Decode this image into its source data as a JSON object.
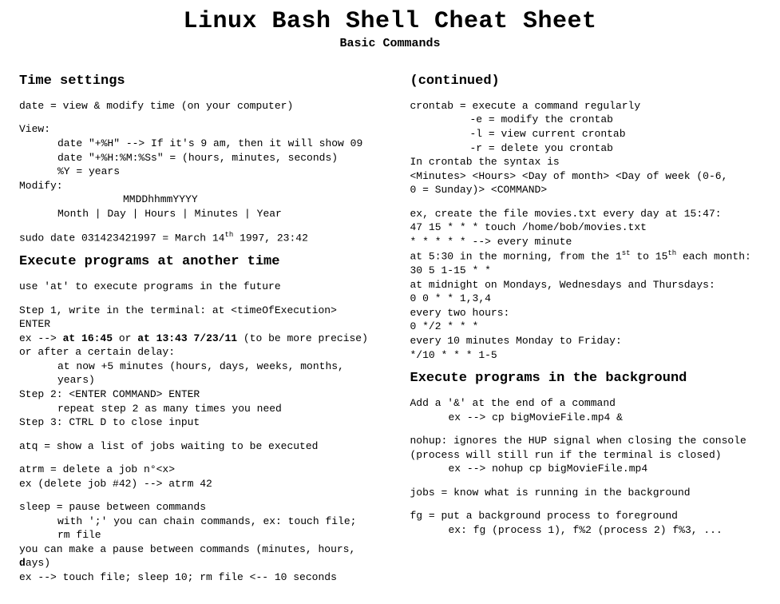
{
  "title": "Linux Bash Shell Cheat Sheet",
  "subtitle": "Basic Commands",
  "left": {
    "h1": "Time settings",
    "l1": "date = view & modify time (on your computer)",
    "l2": "View:",
    "l3": "date \"+%H\" --> If it's 9 am, then it will show 09",
    "l4": "date \"+%H:%M:%Ss\" = (hours, minutes, seconds)",
    "l5": "%Y = years",
    "l6": "Modify:",
    "l7": "MMDDhhmmYYYY",
    "l8": "Month | Day | Hours | Minutes | Year",
    "l9a": "sudo date 031423421997 = March 14",
    "l9sup": "th",
    "l9b": " 1997, 23:42",
    "h2": "Execute programs at another time",
    "l10": "use 'at' to execute programs in the future",
    "l11": "Step 1, write in the terminal: at <timeOfExecution> ENTER",
    "l12a": "ex --> ",
    "l12b": "at 16:45",
    "l12c": " or ",
    "l12d": "at 13:43 7/23/11",
    "l12e": " (to be more precise)",
    "l13": "or after a certain delay:",
    "l14": "at now +5 minutes (hours, days, weeks, months, years)",
    "l15": "Step 2: <ENTER COMMAND> ENTER",
    "l16": "repeat step 2 as many times you need",
    "l17": "Step 3: CTRL D to close input",
    "l18": "atq = show a list of jobs waiting to be executed",
    "l19": "atrm = delete a job n°<x>",
    "l20": "ex (delete job #42) --> atrm 42",
    "l21": "sleep = pause between commands",
    "l22": "with ';' you can chain commands, ex: touch file; rm file",
    "l23a": "you can make a pause between commands (minutes, hours, ",
    "l23b": "d",
    "l23c": "ays)",
    "l24": "ex --> touch file; sleep 10; rm file <-- 10 seconds"
  },
  "right": {
    "h1": "(continued)",
    "l1": "crontab = execute a command regularly",
    "l2": "-e = modify the crontab",
    "l3": "-l = view current crontab",
    "l4": "-r = delete you crontab",
    "l5": "In crontab the syntax is",
    "l6": "<Minutes> <Hours> <Day of month> <Day of week (0-6,",
    "l7": "0 = Sunday)> <COMMAND>",
    "l8": "ex, create the file movies.txt every day at 15:47:",
    "l9": "47 15 * * * touch /home/bob/movies.txt",
    "l10": "* * * * * --> every minute",
    "l11a": "at 5:30 in the morning, from the 1",
    "l11sup1": "st",
    "l11b": " to 15",
    "l11sup2": "th",
    "l11c": " each month:",
    "l12": "30 5 1-15 * *",
    "l13": "at midnight on Mondays, Wednesdays and Thursdays:",
    "l14": "0 0 * * 1,3,4",
    "l15": "every two hours:",
    "l16": "0 */2 * * *",
    "l17": "every 10 minutes Monday to Friday:",
    "l18": "*/10 * * * 1-5",
    "h2": "Execute programs in the background",
    "l19": "Add a '&' at the end of a command",
    "l20": "ex --> cp bigMovieFile.mp4 &",
    "l21": "nohup: ignores the HUP signal when closing the console",
    "l22": "(process will still run if the terminal is closed)",
    "l23": "ex --> nohup cp bigMovieFile.mp4",
    "l24": "jobs = know what is running in the background",
    "l25": "fg = put a background process to foreground",
    "l26": "ex: fg (process 1), f%2 (process 2) f%3, ..."
  }
}
